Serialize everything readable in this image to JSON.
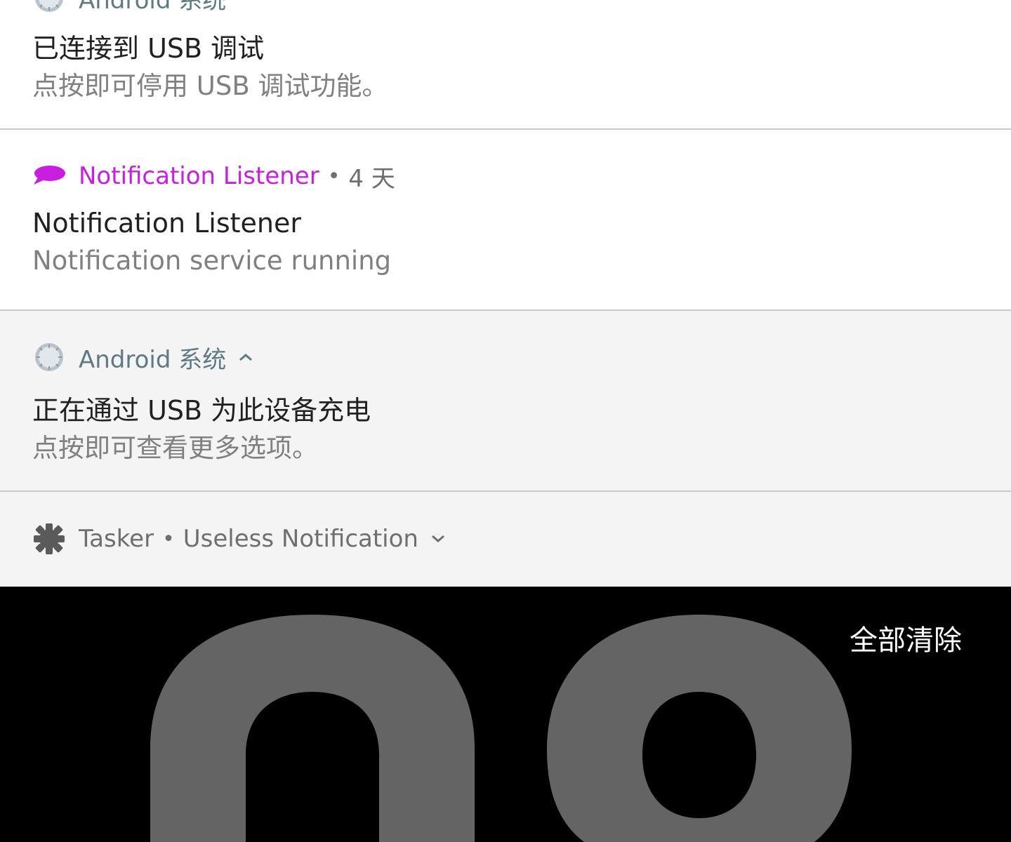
{
  "notifications": [
    {
      "app_name": "Android 系统",
      "title": "已连接到 USB 调试",
      "text": "点按即可停用 USB 调试功能。"
    },
    {
      "app_name": "Notification Listener",
      "time": "4 天",
      "title": "Notification Listener",
      "text": "Notification service running",
      "accent_color": "#c81ee0"
    },
    {
      "app_name": "Android 系统",
      "title": "正在通过 USB 为此设备充电",
      "text": "点按即可查看更多选项。"
    },
    {
      "app_name": "Tasker",
      "subtext": "Useless Notification"
    }
  ],
  "separator": "•",
  "clear_all_label": "全部清除",
  "icons": {
    "android_system": "android-system-icon",
    "notification_listener": "speech-bubble-icon",
    "tasker": "gear-icon",
    "collapse": "chevron-up-icon",
    "expand": "chevron-down-icon"
  },
  "colors": {
    "app_name": "#5f7a85",
    "listener_accent": "#c81ee0",
    "card_white": "#ffffff",
    "card_grey": "#f4f4f4"
  }
}
